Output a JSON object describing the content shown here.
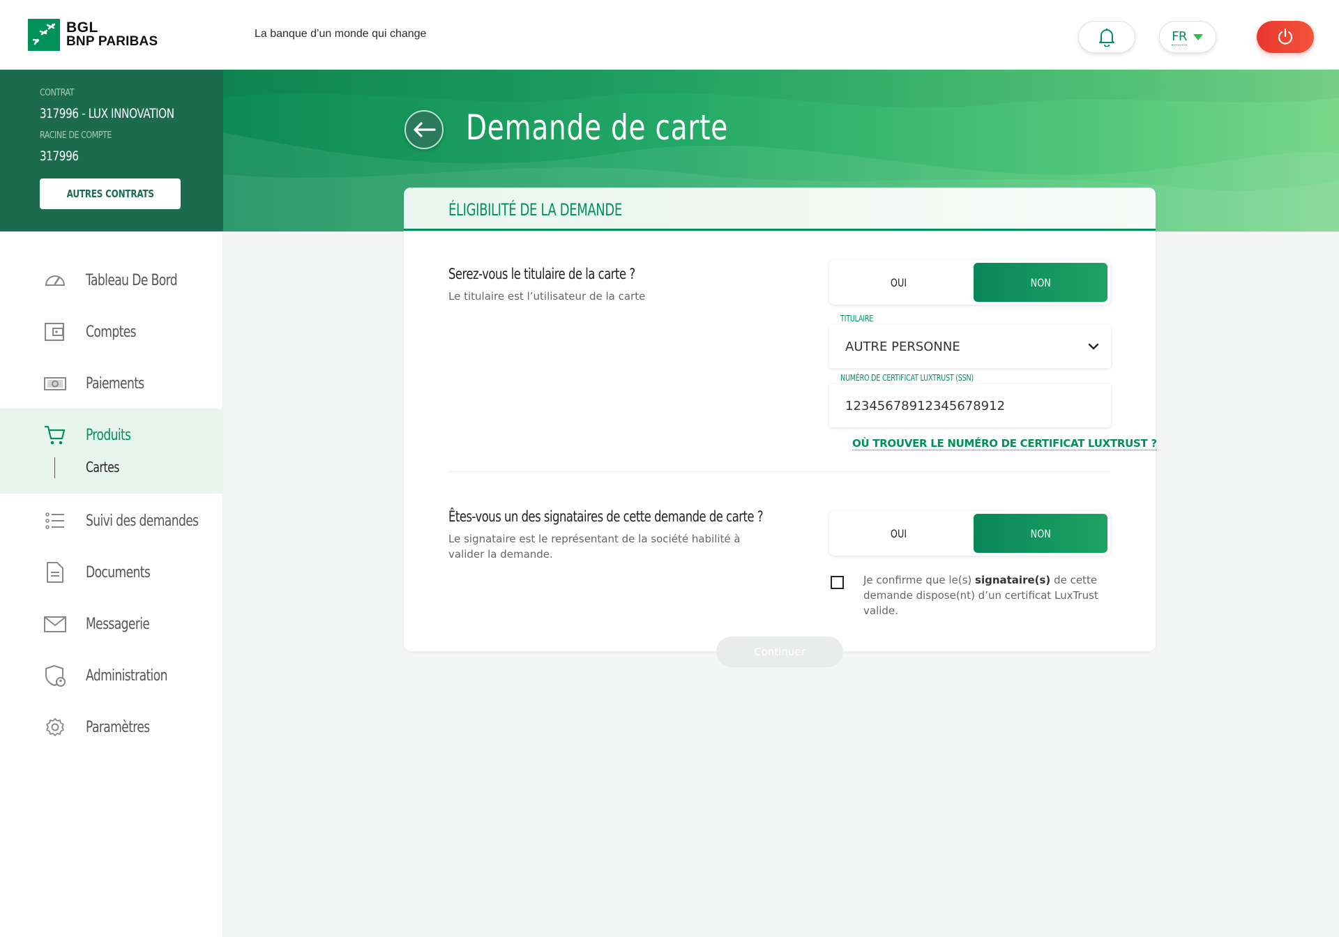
{
  "header": {
    "brand_line1": "BGL",
    "brand_line2": "BNP PARIBAS",
    "tagline": "La banque d’un monde qui change",
    "language": "FR"
  },
  "contract": {
    "contract_label": "CONTRAT",
    "contract_value": "317996 - LUX INNOVATION",
    "root_label": "RACINE DE COMPTE",
    "root_value": "317996",
    "other_contracts_button": "AUTRES CONTRATS"
  },
  "sidebar": {
    "items": [
      {
        "label": "Tableau De Bord",
        "icon": "dashboard-icon"
      },
      {
        "label": "Comptes",
        "icon": "wallet-icon"
      },
      {
        "label": "Paiements",
        "icon": "banknote-icon"
      },
      {
        "label": "Produits",
        "icon": "cart-icon",
        "active": true
      },
      {
        "label": "Suivi des demandes",
        "icon": "list-icon"
      },
      {
        "label": "Documents",
        "icon": "document-icon"
      },
      {
        "label": "Messagerie",
        "icon": "mail-icon"
      },
      {
        "label": "Administration",
        "icon": "shield-user-icon"
      },
      {
        "label": "Paramètres",
        "icon": "gear-icon"
      }
    ],
    "sub_item": "Cartes"
  },
  "page": {
    "title": "Demande de carte",
    "section_title": "ÉLIGIBILITÉ DE LA DEMANDE"
  },
  "q1": {
    "title": "Serez-vous le titulaire de la carte ?",
    "subtitle": "Le titulaire est l’utilisateur de la carte",
    "yes": "OUI",
    "no": "NON",
    "selected": "NON"
  },
  "holder_field": {
    "label": "TITULAIRE",
    "value": "AUTRE PERSONNE"
  },
  "cert_field": {
    "label": "NUMÉRO DE CERTIFICAT LUXTRUST (SSN)",
    "value": "12345678912345678912"
  },
  "help_link": "OÙ TROUVER LE NUMÉRO DE CERTIFICAT LUXTRUST ?",
  "q2": {
    "title": "Êtes-vous un des signataires de cette demande de carte ?",
    "subtitle": "Le signataire est le représentant de la société habilité à valider la demande.",
    "yes": "OUI",
    "no": "NON",
    "selected": "NON"
  },
  "confirm": {
    "before": "Je confirme que le(s) ",
    "bold": "signataire(s)",
    "after": " de cette demande dispose(nt) d’un certificat LuxTrust valide.",
    "checked": false
  },
  "continue_button": "Continuer",
  "colors": {
    "brand_green": "#00915a",
    "sidebar_dark": "#1d6b4f",
    "power_red": "#e8382e"
  }
}
